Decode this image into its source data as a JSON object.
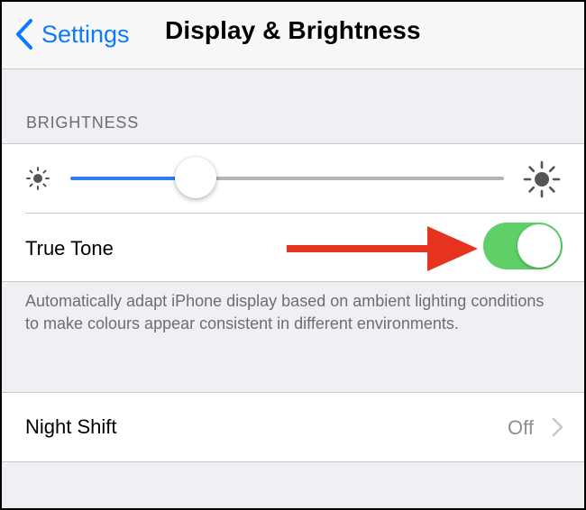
{
  "navbar": {
    "back_label": "Settings",
    "back_icon": "chevron-left-icon",
    "title": "Display & Brightness"
  },
  "brightness_section": {
    "header": "BRIGHTNESS",
    "slider": {
      "level": 0.29,
      "min_icon": "sun-small-icon",
      "max_icon": "sun-large-icon"
    },
    "true_tone": {
      "label": "True Tone",
      "enabled": true
    },
    "annotation_arrow": "red-arrow-icon",
    "footer": "Automatically adapt iPhone display based on ambient lighting conditions to make colours appear consistent in different environments."
  },
  "night_shift": {
    "label": "Night Shift",
    "value": "Off",
    "icon": "chevron-right-icon"
  },
  "colors": {
    "accent_blue": "#0a7bff",
    "slider_fill": "#2f7df6",
    "slider_track": "#b5b5b5",
    "toggle_on": "#5fd068",
    "annotation_red": "#e5331f",
    "group_background": "#efeff4",
    "secondary_text": "#6d6d72"
  }
}
